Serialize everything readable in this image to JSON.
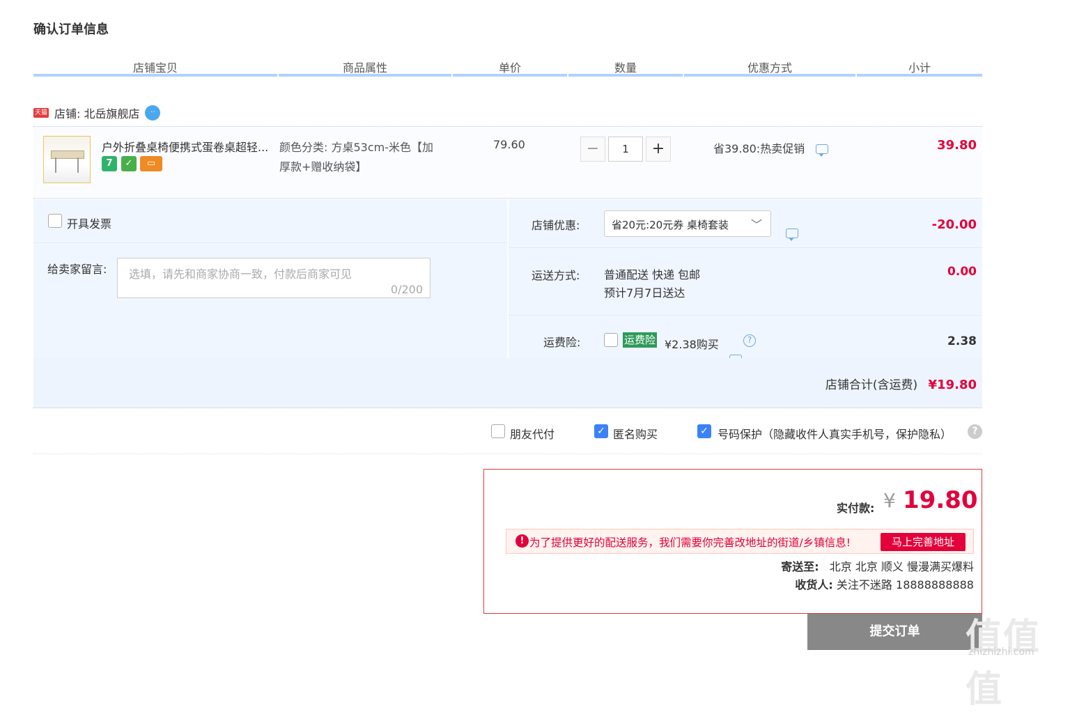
{
  "page_title": "确认订单信息",
  "columns": [
    "店铺宝贝",
    "商品属性",
    "单价",
    "数量",
    "优惠方式",
    "小计"
  ],
  "shop": {
    "tag": "天猫",
    "label": "店铺: 北岳旗舰店"
  },
  "item": {
    "name": "户外折叠桌椅便携式蛋卷桌超轻...",
    "badge_seven": "7",
    "attr_line1": "颜色分类: 方桌53cm-米色【加",
    "attr_line2": "厚款+赠收纳袋】",
    "price": "79.60",
    "qty": "1",
    "minus": "−",
    "plus": "+",
    "promo": "省39.80:热卖促销",
    "subtotal": "39.80"
  },
  "invoice_label": "开具发票",
  "message": {
    "label": "给卖家留言:",
    "placeholder": "选填，请先和商家协商一致，付款后商家可见",
    "counter": "0/200"
  },
  "shop_discount": {
    "label": "店铺优惠:",
    "selected": "省20元:20元券 桌椅套装",
    "amount": "-20.00"
  },
  "shipping": {
    "label": "运送方式:",
    "method": "普通配送 快递 包邮",
    "eta": "预计7月7日送达",
    "amount": "0.00"
  },
  "insurance": {
    "label": "运费险:",
    "tag": "运费险",
    "price": "¥2.38购买",
    "amount": "2.38"
  },
  "shop_total": {
    "label": "店铺合计(含运费)",
    "amount": "¥19.80"
  },
  "options": {
    "friend_pay": "朋友代付",
    "anonymous": "匿名购买",
    "number_protect": "号码保护（隐藏收件人真实手机号，保护隐私）"
  },
  "payment": {
    "label": "实付款:",
    "currency": "¥",
    "amount": "19.80",
    "warning": "为了提供更好的配送服务，我们需要你完善改地址的街道/乡镇信息!",
    "warning_button": "马上完善地址",
    "ship_to_label": "寄送至:",
    "ship_to": "北京 北京 顺义 慢漫满买爆料",
    "receiver_label": "收货人:",
    "receiver": "关注不迷路 18888888888"
  },
  "submit_label": "提交订单",
  "watermark": {
    "text": "值值值",
    "domain": "zhizhizhi.com"
  },
  "colors": {
    "price_red": "#e4003a",
    "header_line": "#b2d1ff",
    "panel_bg": "#f0f6ff",
    "submit_gray": "#888888"
  }
}
